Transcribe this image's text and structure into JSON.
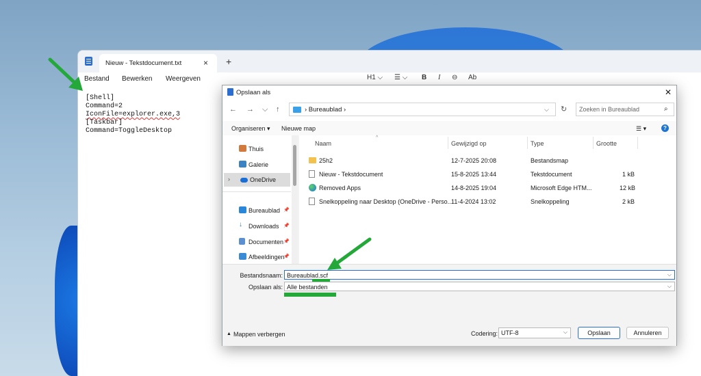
{
  "notepad": {
    "tab_title": "Nieuw - Tekstdocument.txt",
    "tab_close": "×",
    "tab_add": "+",
    "menu": [
      "Bestand",
      "Bewerken",
      "Weergeven"
    ],
    "format_bar": {
      "heading": "H1 ⌵",
      "list": "☰ ⌵",
      "bold": "B",
      "italic": "I",
      "link": "⊖",
      "clear": "Ab"
    },
    "lines": [
      "[Shell]",
      "Command=2",
      "IconFile=explorer.exe,3",
      "[Taskbar]",
      "Command=ToggleDesktop"
    ]
  },
  "dialog": {
    "title": "Opslaan als",
    "close": "✕",
    "nav": {
      "back": "←",
      "forward": "→",
      "down": "⌵",
      "up": "↑",
      "refresh": "↻",
      "addr_chevron": "⌵"
    },
    "breadcrumb": "›  Bureaublad  ›",
    "search_placeholder": "Zoeken in Bureaublad",
    "toolbar": {
      "organize": "Organiseren ▾",
      "new_folder": "Nieuwe map",
      "view": "☰ ▾",
      "help": "?"
    },
    "nav_items": [
      {
        "label": "Thuis",
        "pin": ""
      },
      {
        "label": "Galerie",
        "pin": ""
      },
      {
        "label": "OneDrive",
        "pin": "",
        "expander": "›"
      },
      {
        "label": "Bureaublad",
        "pin": "📌"
      },
      {
        "label": "Downloads",
        "pin": "📌"
      },
      {
        "label": "Documenten",
        "pin": "📌"
      },
      {
        "label": "Afbeeldingen",
        "pin": "📌"
      }
    ],
    "columns": {
      "name": "Naam",
      "modified": "Gewijzigd op",
      "type": "Type",
      "size": "Grootte"
    },
    "files": [
      {
        "name": "25h2",
        "modified": "12-7-2025 20:08",
        "type": "Bestandsmap",
        "size": ""
      },
      {
        "name": "Nieuw - Tekstdocument",
        "modified": "15-8-2025 13:44",
        "type": "Tekstdocument",
        "size": "1 kB"
      },
      {
        "name": "Removed Apps",
        "modified": "14-8-2025 19:04",
        "type": "Microsoft Edge HTM...",
        "size": "12 kB"
      },
      {
        "name": "Snelkoppeling naar Desktop (OneDrive - Perso...",
        "modified": "11-4-2024 13:02",
        "type": "Snelkoppeling",
        "size": "2 kB"
      }
    ],
    "filename_label": "Bestandsnaam:",
    "filename_value": "Bureaublad.scf",
    "savetype_label": "Opslaan als:",
    "savetype_value": "Alle bestanden",
    "hide_folders": "Mappen verbergen",
    "encoding_label": "Codering:",
    "encoding_value": "UTF-8",
    "save_button": "Opslaan",
    "cancel_button": "Annuleren",
    "dropdown_chevron": "⌵"
  },
  "colors": {
    "accent": "#2b6ecf",
    "annotation": "#24a83a"
  }
}
